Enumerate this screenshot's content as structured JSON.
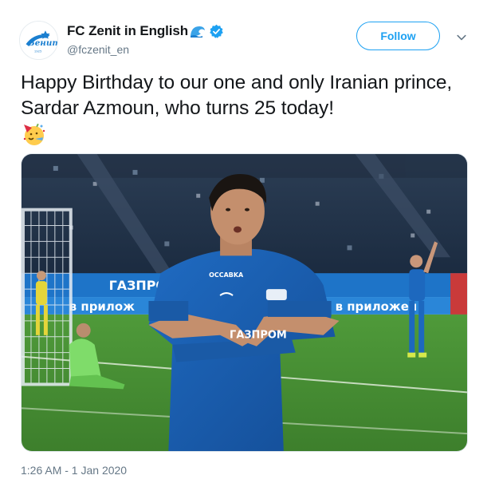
{
  "tweet": {
    "author": {
      "display_name": "FC Zenit in English",
      "handle": "@fczenit_en",
      "avatar_icon": "zenit-logo-icon",
      "badge_icons": [
        "wave-emoji-icon",
        "verified-badge-icon"
      ]
    },
    "follow_label": "Follow",
    "menu_icon": "chevron-down-icon",
    "text": "Happy Birthday to our one and only Iranian prince, Sardar Azmoun, who turns 25 today!",
    "emoji": "party-face-emoji-icon",
    "media": {
      "pitchboard_text_1": "ГАЗПРОМ",
      "pitchboard_text_2": "в прилож",
      "pitchboard_text_3": "в приложен",
      "jersey_sponsor": "ГАЗПРОМ",
      "sleeve_sponsor": "OCCABKA"
    },
    "timestamp": "1:26 AM - 1 Jan 2020"
  },
  "colors": {
    "accent": "#1da1f2",
    "text_primary": "#14171a",
    "text_secondary": "#657786",
    "zenit_blue": "#1b5fb0"
  }
}
